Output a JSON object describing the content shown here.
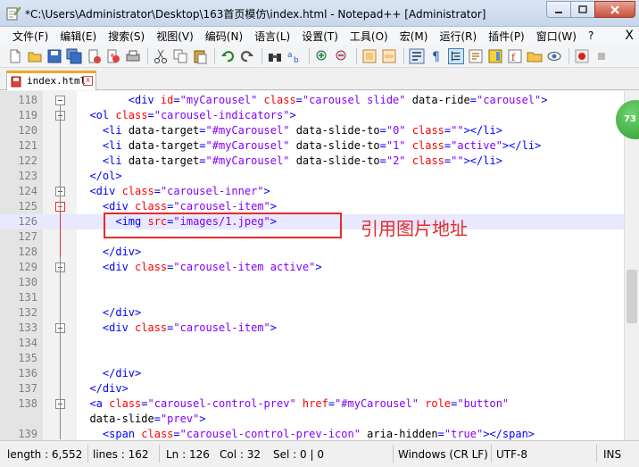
{
  "window": {
    "title": "*C:\\Users\\Administrator\\Desktop\\163首页模仿\\index.html - Notepad++ [Administrator]"
  },
  "menu": {
    "items": [
      "文件(F)",
      "编辑(E)",
      "搜索(S)",
      "视图(V)",
      "编码(N)",
      "语言(L)",
      "设置(T)",
      "工具(O)",
      "宏(M)",
      "运行(R)",
      "插件(P)",
      "窗口(W)",
      "?"
    ],
    "close_glyph": "X"
  },
  "tabs": [
    {
      "label": "index.html",
      "close_glyph": "x"
    }
  ],
  "editor": {
    "lines": [
      {
        "n": "118",
        "fold": "box",
        "segs": [
          [
            "txt",
            "        "
          ],
          [
            "tag",
            "<div "
          ],
          [
            "attr",
            "id"
          ],
          [
            "tag",
            "="
          ],
          [
            "val",
            "\"myCarousel\""
          ],
          [
            "tag",
            " "
          ],
          [
            "attr",
            "class"
          ],
          [
            "tag",
            "="
          ],
          [
            "val",
            "\"carousel slide\""
          ],
          [
            "tag",
            " "
          ],
          [
            "txt",
            "data-ride"
          ],
          [
            "tag",
            "="
          ],
          [
            "val",
            "\"carousel\""
          ],
          [
            "tag",
            ">"
          ]
        ]
      },
      {
        "n": "119",
        "fold": "box",
        "segs": [
          [
            "txt",
            "  "
          ],
          [
            "tag",
            "<ol "
          ],
          [
            "attr",
            "class"
          ],
          [
            "tag",
            "="
          ],
          [
            "val",
            "\"carousel-indicators\""
          ],
          [
            "tag",
            ">"
          ]
        ]
      },
      {
        "n": "120",
        "fold": "",
        "segs": [
          [
            "txt",
            "    "
          ],
          [
            "tag",
            "<li "
          ],
          [
            "txt",
            "data-target"
          ],
          [
            "tag",
            "="
          ],
          [
            "val",
            "\"#myCarousel\""
          ],
          [
            "tag",
            " "
          ],
          [
            "txt",
            "data-slide-to"
          ],
          [
            "tag",
            "="
          ],
          [
            "val",
            "\"0\""
          ],
          [
            "tag",
            " "
          ],
          [
            "attr",
            "class"
          ],
          [
            "tag",
            "="
          ],
          [
            "val",
            "\"\""
          ],
          [
            "tag",
            "></li>"
          ]
        ]
      },
      {
        "n": "121",
        "fold": "",
        "segs": [
          [
            "txt",
            "    "
          ],
          [
            "tag",
            "<li "
          ],
          [
            "txt",
            "data-target"
          ],
          [
            "tag",
            "="
          ],
          [
            "val",
            "\"#myCarousel\""
          ],
          [
            "tag",
            " "
          ],
          [
            "txt",
            "data-slide-to"
          ],
          [
            "tag",
            "="
          ],
          [
            "val",
            "\"1\""
          ],
          [
            "tag",
            " "
          ],
          [
            "attr",
            "class"
          ],
          [
            "tag",
            "="
          ],
          [
            "val",
            "\"active\""
          ],
          [
            "tag",
            "></li>"
          ]
        ]
      },
      {
        "n": "122",
        "fold": "",
        "segs": [
          [
            "txt",
            "    "
          ],
          [
            "tag",
            "<li "
          ],
          [
            "txt",
            "data-target"
          ],
          [
            "tag",
            "="
          ],
          [
            "val",
            "\"#myCarousel\""
          ],
          [
            "tag",
            " "
          ],
          [
            "txt",
            "data-slide-to"
          ],
          [
            "tag",
            "="
          ],
          [
            "val",
            "\"2\""
          ],
          [
            "tag",
            " "
          ],
          [
            "attr",
            "class"
          ],
          [
            "tag",
            "="
          ],
          [
            "val",
            "\"\""
          ],
          [
            "tag",
            "></li>"
          ]
        ]
      },
      {
        "n": "123",
        "fold": "",
        "segs": [
          [
            "txt",
            "  "
          ],
          [
            "tag",
            "</ol>"
          ]
        ]
      },
      {
        "n": "124",
        "fold": "box",
        "segs": [
          [
            "txt",
            "  "
          ],
          [
            "tag",
            "<div "
          ],
          [
            "attr",
            "class"
          ],
          [
            "tag",
            "="
          ],
          [
            "val",
            "\"carousel-inner\""
          ],
          [
            "tag",
            ">"
          ]
        ]
      },
      {
        "n": "125",
        "fold": "red",
        "segs": [
          [
            "txt",
            "    "
          ],
          [
            "tag",
            "<div "
          ],
          [
            "attr",
            "class"
          ],
          [
            "tag",
            "="
          ],
          [
            "val",
            "\"carousel-item\""
          ],
          [
            "tag",
            ">"
          ]
        ]
      },
      {
        "n": "126",
        "fold": "",
        "hl": true,
        "segs": [
          [
            "txt",
            "      "
          ],
          [
            "tag",
            "<img "
          ],
          [
            "attr",
            "src"
          ],
          [
            "tag",
            "="
          ],
          [
            "val",
            "\"images/1.jpeg\""
          ],
          [
            "tag",
            ">"
          ]
        ]
      },
      {
        "n": "127",
        "fold": "",
        "segs": []
      },
      {
        "n": "128",
        "fold": "",
        "segs": [
          [
            "txt",
            "    "
          ],
          [
            "tag",
            "</div>"
          ]
        ]
      },
      {
        "n": "129",
        "fold": "box",
        "segs": [
          [
            "txt",
            "    "
          ],
          [
            "tag",
            "<div "
          ],
          [
            "attr",
            "class"
          ],
          [
            "tag",
            "="
          ],
          [
            "val",
            "\"carousel-item active\""
          ],
          [
            "tag",
            ">"
          ]
        ]
      },
      {
        "n": "130",
        "fold": "",
        "segs": []
      },
      {
        "n": "131",
        "fold": "",
        "segs": []
      },
      {
        "n": "132",
        "fold": "",
        "segs": [
          [
            "txt",
            "    "
          ],
          [
            "tag",
            "</div>"
          ]
        ]
      },
      {
        "n": "133",
        "fold": "box",
        "segs": [
          [
            "txt",
            "    "
          ],
          [
            "tag",
            "<div "
          ],
          [
            "attr",
            "class"
          ],
          [
            "tag",
            "="
          ],
          [
            "val",
            "\"carousel-item\""
          ],
          [
            "tag",
            ">"
          ]
        ]
      },
      {
        "n": "134",
        "fold": "",
        "segs": []
      },
      {
        "n": "135",
        "fold": "",
        "segs": []
      },
      {
        "n": "136",
        "fold": "",
        "segs": [
          [
            "txt",
            "    "
          ],
          [
            "tag",
            "</div>"
          ]
        ]
      },
      {
        "n": "137",
        "fold": "",
        "segs": [
          [
            "txt",
            "  "
          ],
          [
            "tag",
            "</div>"
          ]
        ]
      },
      {
        "n": "138",
        "fold": "box",
        "segs": [
          [
            "txt",
            "  "
          ],
          [
            "tag",
            "<a "
          ],
          [
            "attr",
            "class"
          ],
          [
            "tag",
            "="
          ],
          [
            "val",
            "\"carousel-control-prev\""
          ],
          [
            "tag",
            " "
          ],
          [
            "attr",
            "href"
          ],
          [
            "tag",
            "="
          ],
          [
            "val",
            "\"#myCarousel\""
          ],
          [
            "tag",
            " "
          ],
          [
            "attr",
            "role"
          ],
          [
            "tag",
            "="
          ],
          [
            "val",
            "\"button\""
          ]
        ]
      },
      {
        "n": "",
        "fold": "",
        "segs": [
          [
            "txt",
            "  data-slide"
          ],
          [
            "tag",
            "="
          ],
          [
            "val",
            "\"prev\""
          ],
          [
            "tag",
            ">"
          ]
        ]
      },
      {
        "n": "139",
        "fold": "",
        "segs": [
          [
            "txt",
            "    "
          ],
          [
            "tag",
            "<span "
          ],
          [
            "attr",
            "class"
          ],
          [
            "tag",
            "="
          ],
          [
            "val",
            "\"carousel-control-prev-icon\""
          ],
          [
            "tag",
            " "
          ],
          [
            "txt",
            "aria-hidden"
          ],
          [
            "tag",
            "="
          ],
          [
            "val",
            "\"true\""
          ],
          [
            "tag",
            "></span>"
          ]
        ]
      }
    ],
    "annotation_text": "引用图片地址",
    "badge_text": "73"
  },
  "status": {
    "length": "length : 6,552",
    "lines": "lines : 162",
    "ln": "Ln : 126",
    "col": "Col : 32",
    "sel": "Sel : 0 | 0",
    "eol": "Windows (CR LF)",
    "encoding": "UTF-8",
    "mode": "INS"
  },
  "colors": {
    "tag": "#0000ff",
    "attr": "#ff0000",
    "value": "#8000ff",
    "annotation": "#e52b2b"
  }
}
